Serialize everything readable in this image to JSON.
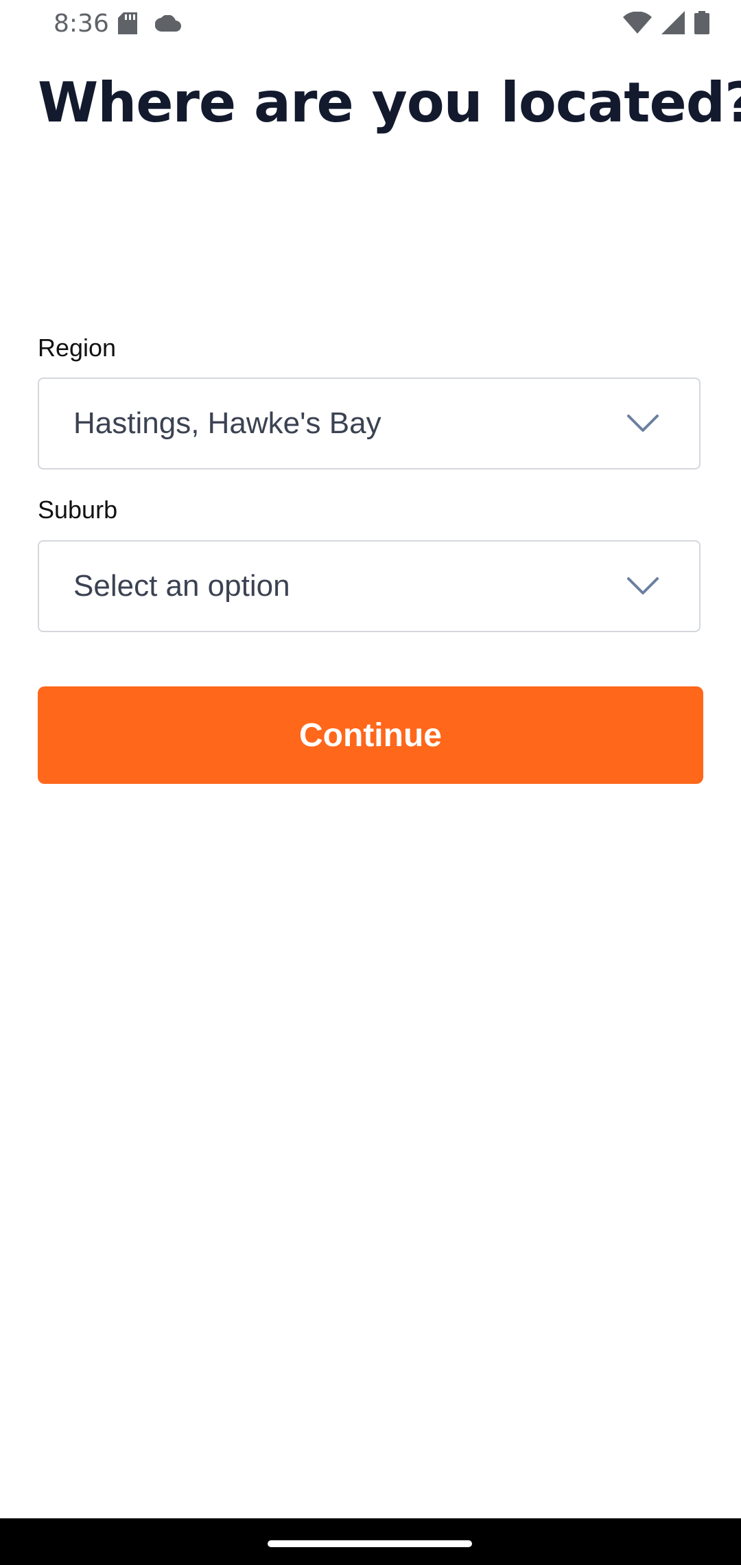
{
  "status_bar": {
    "time": "8:36",
    "icons": [
      "sd-card-icon",
      "cloud-icon",
      "wifi-icon",
      "signal-icon",
      "battery-icon"
    ]
  },
  "page": {
    "title": "Where are you located?"
  },
  "form": {
    "region": {
      "label": "Region",
      "value": "Hastings, Hawke's Bay"
    },
    "suburb": {
      "label": "Suburb",
      "value": "Select an option"
    },
    "continue_label": "Continue"
  },
  "colors": {
    "accent": "#ff671b",
    "title": "#131a2e",
    "field_border": "#d4d7dd",
    "field_text": "#3b4252",
    "chevron": "#6b7fa0"
  }
}
